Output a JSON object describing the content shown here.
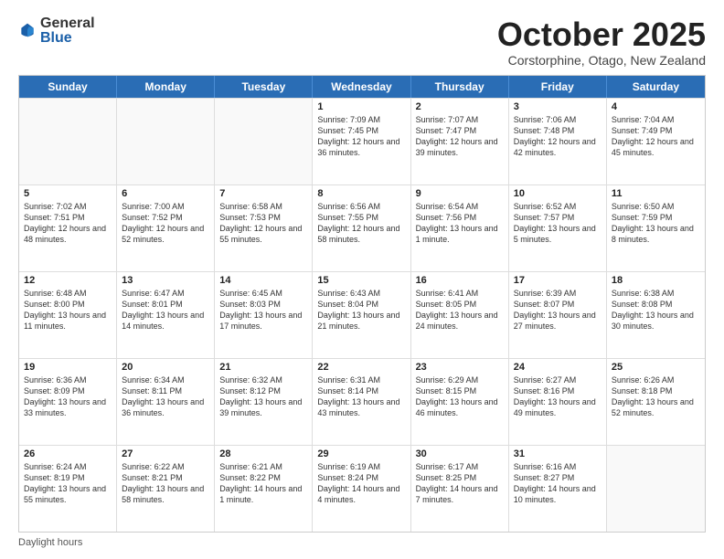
{
  "logo": {
    "general": "General",
    "blue": "Blue"
  },
  "header": {
    "month": "October 2025",
    "location": "Corstorphine, Otago, New Zealand"
  },
  "weekdays": [
    "Sunday",
    "Monday",
    "Tuesday",
    "Wednesday",
    "Thursday",
    "Friday",
    "Saturday"
  ],
  "footer": {
    "daylight_label": "Daylight hours"
  },
  "weeks": [
    [
      {
        "day": "",
        "sunrise": "",
        "sunset": "",
        "daylight": "",
        "empty": true
      },
      {
        "day": "",
        "sunrise": "",
        "sunset": "",
        "daylight": "",
        "empty": true
      },
      {
        "day": "",
        "sunrise": "",
        "sunset": "",
        "daylight": "",
        "empty": true
      },
      {
        "day": "1",
        "sunrise": "Sunrise: 7:09 AM",
        "sunset": "Sunset: 7:45 PM",
        "daylight": "Daylight: 12 hours and 36 minutes."
      },
      {
        "day": "2",
        "sunrise": "Sunrise: 7:07 AM",
        "sunset": "Sunset: 7:47 PM",
        "daylight": "Daylight: 12 hours and 39 minutes."
      },
      {
        "day": "3",
        "sunrise": "Sunrise: 7:06 AM",
        "sunset": "Sunset: 7:48 PM",
        "daylight": "Daylight: 12 hours and 42 minutes."
      },
      {
        "day": "4",
        "sunrise": "Sunrise: 7:04 AM",
        "sunset": "Sunset: 7:49 PM",
        "daylight": "Daylight: 12 hours and 45 minutes."
      }
    ],
    [
      {
        "day": "5",
        "sunrise": "Sunrise: 7:02 AM",
        "sunset": "Sunset: 7:51 PM",
        "daylight": "Daylight: 12 hours and 48 minutes."
      },
      {
        "day": "6",
        "sunrise": "Sunrise: 7:00 AM",
        "sunset": "Sunset: 7:52 PM",
        "daylight": "Daylight: 12 hours and 52 minutes."
      },
      {
        "day": "7",
        "sunrise": "Sunrise: 6:58 AM",
        "sunset": "Sunset: 7:53 PM",
        "daylight": "Daylight: 12 hours and 55 minutes."
      },
      {
        "day": "8",
        "sunrise": "Sunrise: 6:56 AM",
        "sunset": "Sunset: 7:55 PM",
        "daylight": "Daylight: 12 hours and 58 minutes."
      },
      {
        "day": "9",
        "sunrise": "Sunrise: 6:54 AM",
        "sunset": "Sunset: 7:56 PM",
        "daylight": "Daylight: 13 hours and 1 minute."
      },
      {
        "day": "10",
        "sunrise": "Sunrise: 6:52 AM",
        "sunset": "Sunset: 7:57 PM",
        "daylight": "Daylight: 13 hours and 5 minutes."
      },
      {
        "day": "11",
        "sunrise": "Sunrise: 6:50 AM",
        "sunset": "Sunset: 7:59 PM",
        "daylight": "Daylight: 13 hours and 8 minutes."
      }
    ],
    [
      {
        "day": "12",
        "sunrise": "Sunrise: 6:48 AM",
        "sunset": "Sunset: 8:00 PM",
        "daylight": "Daylight: 13 hours and 11 minutes."
      },
      {
        "day": "13",
        "sunrise": "Sunrise: 6:47 AM",
        "sunset": "Sunset: 8:01 PM",
        "daylight": "Daylight: 13 hours and 14 minutes."
      },
      {
        "day": "14",
        "sunrise": "Sunrise: 6:45 AM",
        "sunset": "Sunset: 8:03 PM",
        "daylight": "Daylight: 13 hours and 17 minutes."
      },
      {
        "day": "15",
        "sunrise": "Sunrise: 6:43 AM",
        "sunset": "Sunset: 8:04 PM",
        "daylight": "Daylight: 13 hours and 21 minutes."
      },
      {
        "day": "16",
        "sunrise": "Sunrise: 6:41 AM",
        "sunset": "Sunset: 8:05 PM",
        "daylight": "Daylight: 13 hours and 24 minutes."
      },
      {
        "day": "17",
        "sunrise": "Sunrise: 6:39 AM",
        "sunset": "Sunset: 8:07 PM",
        "daylight": "Daylight: 13 hours and 27 minutes."
      },
      {
        "day": "18",
        "sunrise": "Sunrise: 6:38 AM",
        "sunset": "Sunset: 8:08 PM",
        "daylight": "Daylight: 13 hours and 30 minutes."
      }
    ],
    [
      {
        "day": "19",
        "sunrise": "Sunrise: 6:36 AM",
        "sunset": "Sunset: 8:09 PM",
        "daylight": "Daylight: 13 hours and 33 minutes."
      },
      {
        "day": "20",
        "sunrise": "Sunrise: 6:34 AM",
        "sunset": "Sunset: 8:11 PM",
        "daylight": "Daylight: 13 hours and 36 minutes."
      },
      {
        "day": "21",
        "sunrise": "Sunrise: 6:32 AM",
        "sunset": "Sunset: 8:12 PM",
        "daylight": "Daylight: 13 hours and 39 minutes."
      },
      {
        "day": "22",
        "sunrise": "Sunrise: 6:31 AM",
        "sunset": "Sunset: 8:14 PM",
        "daylight": "Daylight: 13 hours and 43 minutes."
      },
      {
        "day": "23",
        "sunrise": "Sunrise: 6:29 AM",
        "sunset": "Sunset: 8:15 PM",
        "daylight": "Daylight: 13 hours and 46 minutes."
      },
      {
        "day": "24",
        "sunrise": "Sunrise: 6:27 AM",
        "sunset": "Sunset: 8:16 PM",
        "daylight": "Daylight: 13 hours and 49 minutes."
      },
      {
        "day": "25",
        "sunrise": "Sunrise: 6:26 AM",
        "sunset": "Sunset: 8:18 PM",
        "daylight": "Daylight: 13 hours and 52 minutes."
      }
    ],
    [
      {
        "day": "26",
        "sunrise": "Sunrise: 6:24 AM",
        "sunset": "Sunset: 8:19 PM",
        "daylight": "Daylight: 13 hours and 55 minutes."
      },
      {
        "day": "27",
        "sunrise": "Sunrise: 6:22 AM",
        "sunset": "Sunset: 8:21 PM",
        "daylight": "Daylight: 13 hours and 58 minutes."
      },
      {
        "day": "28",
        "sunrise": "Sunrise: 6:21 AM",
        "sunset": "Sunset: 8:22 PM",
        "daylight": "Daylight: 14 hours and 1 minute."
      },
      {
        "day": "29",
        "sunrise": "Sunrise: 6:19 AM",
        "sunset": "Sunset: 8:24 PM",
        "daylight": "Daylight: 14 hours and 4 minutes."
      },
      {
        "day": "30",
        "sunrise": "Sunrise: 6:17 AM",
        "sunset": "Sunset: 8:25 PM",
        "daylight": "Daylight: 14 hours and 7 minutes."
      },
      {
        "day": "31",
        "sunrise": "Sunrise: 6:16 AM",
        "sunset": "Sunset: 8:27 PM",
        "daylight": "Daylight: 14 hours and 10 minutes."
      },
      {
        "day": "",
        "sunrise": "",
        "sunset": "",
        "daylight": "",
        "empty": true
      }
    ]
  ]
}
